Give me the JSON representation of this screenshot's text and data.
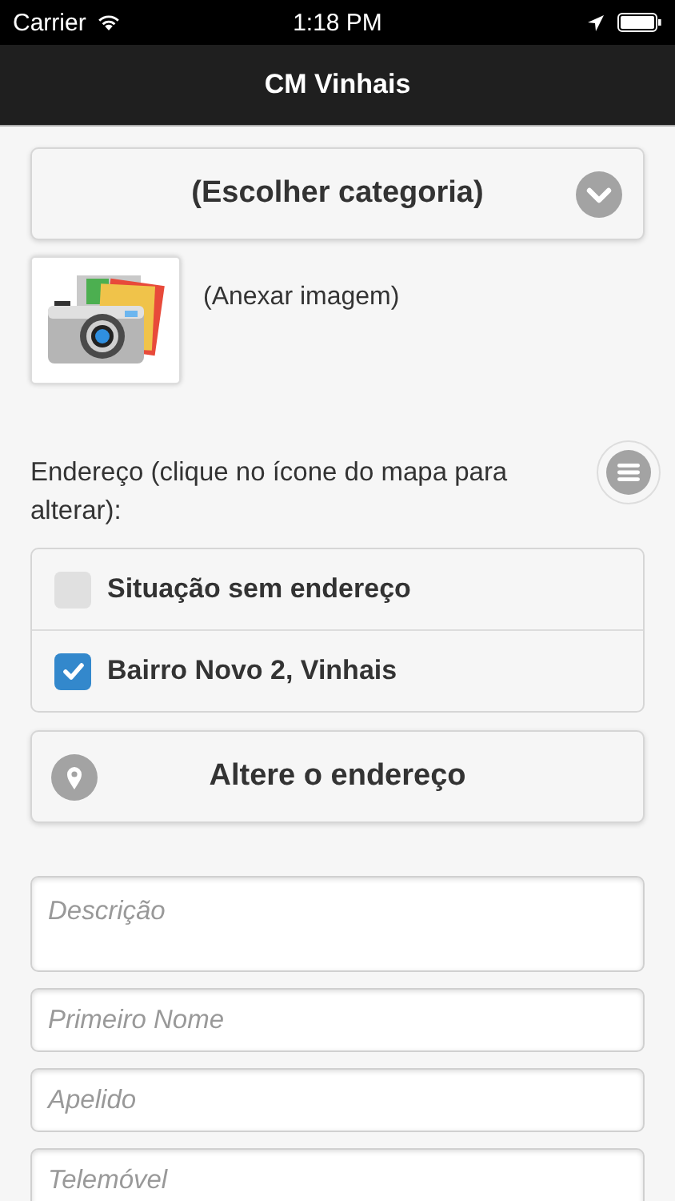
{
  "status_bar": {
    "carrier": "Carrier",
    "time": "1:18 PM"
  },
  "nav_bar": {
    "title": "CM Vinhais"
  },
  "category_select": {
    "label": "(Escolher categoria)"
  },
  "attach_image": {
    "label": "(Anexar imagem)"
  },
  "address": {
    "label": "Endereço (clique no ícone do mapa para alterar):",
    "options": [
      {
        "label": "Situação sem endereço",
        "checked": false
      },
      {
        "label": "Bairro Novo 2, Vinhais",
        "checked": true
      }
    ],
    "change_button": "Altere o endereço"
  },
  "fields": [
    {
      "kind": "multiline",
      "placeholder": "Descrição"
    },
    {
      "kind": "line",
      "placeholder": "Primeiro Nome"
    },
    {
      "kind": "line",
      "placeholder": "Apelido"
    },
    {
      "kind": "line",
      "placeholder": "Telemóvel"
    }
  ]
}
